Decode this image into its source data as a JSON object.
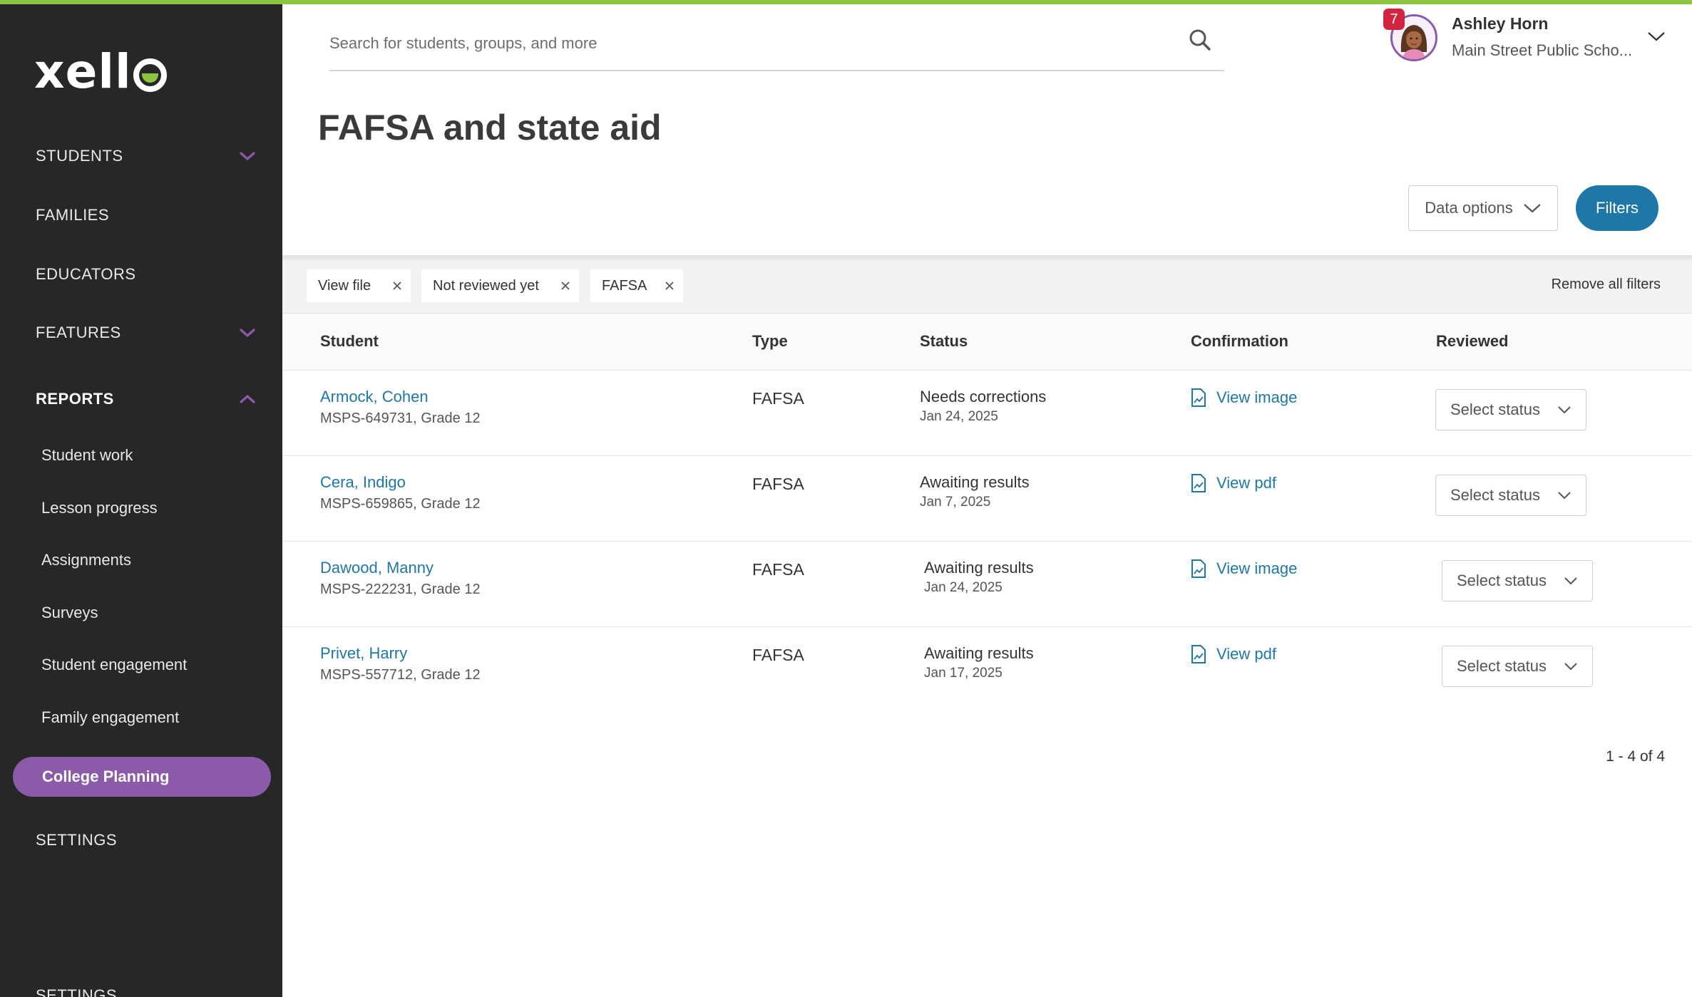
{
  "brand": {
    "logo_text_part": "xell",
    "accent_green": "#8cc63f",
    "accent_purple": "#8b5aa8",
    "link_blue": "#1f77a8"
  },
  "sidebar": {
    "sections": [
      {
        "label": "STUDENTS",
        "icon": "chevron-down-icon"
      },
      {
        "label": "FAMILIES"
      },
      {
        "label": "EDUCATORS"
      },
      {
        "label": "FEATURES",
        "icon": "chevron-down-icon"
      },
      {
        "label": "REPORTS",
        "icon": "chevron-up-icon",
        "expanded": true
      }
    ],
    "report_items": [
      {
        "label": "Student work"
      },
      {
        "label": "Lesson progress"
      },
      {
        "label": "Assignments"
      },
      {
        "label": "Surveys"
      },
      {
        "label": "Student engagement"
      },
      {
        "label": "Family engagement"
      },
      {
        "label": "College Planning",
        "active": true
      }
    ],
    "settings_label": "SETTINGS",
    "settings_label_cut": "SETTINGS"
  },
  "header": {
    "search_placeholder": "Search for students, groups, and more",
    "user": {
      "name": "Ashley Horn",
      "school": "Main Street Public Scho...",
      "notification_count": "7"
    }
  },
  "page": {
    "title": "FAFSA and state aid",
    "data_options_label": "Data options",
    "filters_label": "Filters"
  },
  "filters": {
    "chips": [
      {
        "label": "View file"
      },
      {
        "label": "Not reviewed yet"
      },
      {
        "label": "FAFSA"
      }
    ],
    "remove_all_label": "Remove all filters"
  },
  "table": {
    "columns": [
      "Student",
      "Type",
      "Status",
      "Confirmation",
      "Reviewed"
    ],
    "rows": [
      {
        "name": "Armock, Cohen",
        "meta": "MSPS-649731, Grade 12",
        "type": "FAFSA",
        "status": "Needs corrections",
        "date": "Jan 24, 2025",
        "confirmation": "View image",
        "reviewed": "Select status"
      },
      {
        "name": "Cera, Indigo",
        "meta": "MSPS-659865, Grade 12",
        "type": "FAFSA",
        "status": "Awaiting results",
        "date": "Jan 7, 2025",
        "confirmation": "View pdf",
        "reviewed": "Select status"
      },
      {
        "name": "Dawood, Manny",
        "meta": "MSPS-222231, Grade 12",
        "type": "FAFSA",
        "status": "Awaiting results",
        "date": "Jan 24, 2025",
        "confirmation": "View image",
        "reviewed": "Select status"
      },
      {
        "name": "Privet, Harry",
        "meta": "MSPS-557712, Grade 12",
        "type": "FAFSA",
        "status": "Awaiting results",
        "date": "Jan 17, 2025",
        "confirmation": "View pdf",
        "reviewed": "Select status"
      }
    ],
    "pagination": "1 - 4 of 4"
  }
}
